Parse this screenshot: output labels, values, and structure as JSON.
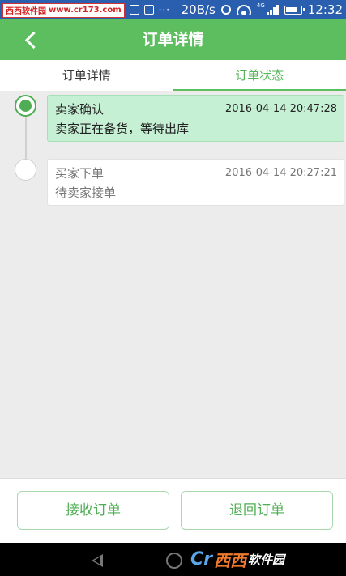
{
  "status_bar": {
    "watermark_brand": "西西软件园",
    "watermark_url": "www.cr173.com",
    "left_icons": [
      "image-icon",
      "image-icon"
    ],
    "dots": "···",
    "network_speed": "20B/s",
    "network_type": "4G",
    "time": "12:32"
  },
  "header": {
    "title": "订单详情"
  },
  "tabs": [
    {
      "label": "订单详情",
      "active": false
    },
    {
      "label": "订单状态",
      "active": true
    }
  ],
  "timeline": [
    {
      "title": "卖家确认",
      "time": "2016-04-14 20:47:28",
      "description": "卖家正在备货，等待出库",
      "active": true
    },
    {
      "title": "买家下单",
      "time": "2016-04-14 20:27:21",
      "description": "待卖家接单",
      "active": false
    }
  ],
  "actions": {
    "receive_label": "接收订单",
    "return_label": "退回订单"
  },
  "nav_bar": {
    "brand_logo": "Cr",
    "brand_xixi": "西西",
    "brand_rest": "软件园",
    "brand_domain": "CR173.COM"
  },
  "colors": {
    "status_bar": "#2a5fb0",
    "header": "#5dbe60",
    "accent": "#4fae53",
    "active_card": "#c5f0d4"
  }
}
